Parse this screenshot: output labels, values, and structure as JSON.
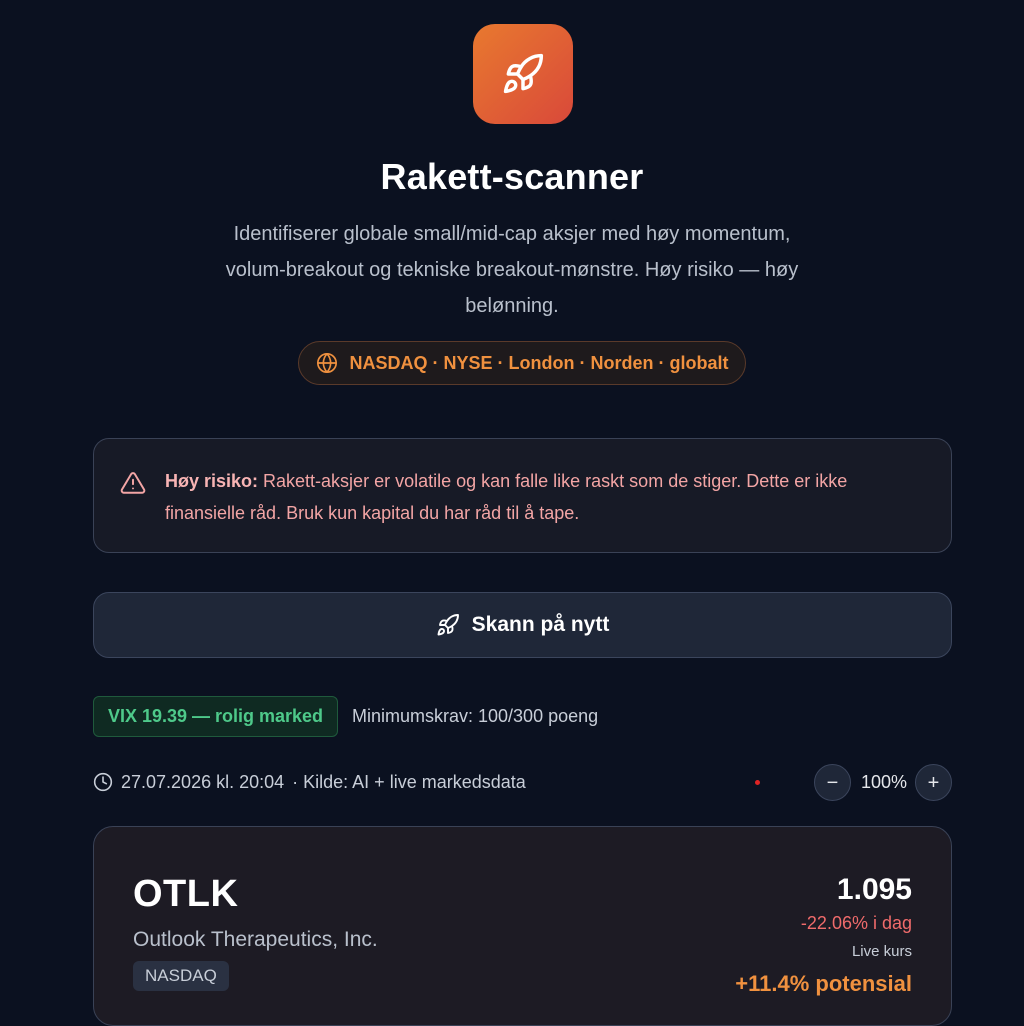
{
  "header": {
    "title": "Rakett-scanner",
    "subtitle": "Identifiserer globale small/mid-cap aksjer med høy momentum, volum-breakout og tekniske breakout-mønstre. Høy risiko — høy belønning.",
    "markets": "NASDAQ · NYSE · London · Norden · globalt"
  },
  "warning": {
    "label": "Høy risiko:",
    "text": " Rakett-aksjer er volatile og kan falle like raskt som de stiger. Dette er ikke finansielle råd. Bruk kun kapital du har råd til å tape."
  },
  "scan_button": {
    "label": "Skann på nytt"
  },
  "status": {
    "vix": "VIX 19.39 — rolig marked",
    "min_requirement": "Minimumskrav: 100/300 poeng",
    "timestamp": "27.07.2026 kl. 20:04",
    "source": "· Kilde: AI + live markedsdata"
  },
  "zoom": {
    "value": "100%",
    "minus": "−",
    "plus": "+"
  },
  "stock": {
    "ticker": "OTLK",
    "company": "Outlook Therapeutics, Inc.",
    "exchange": "NASDAQ",
    "price": "1.095",
    "change": "-22.06% i dag",
    "price_label": "Live kurs",
    "potential": "+11.4% potensial"
  },
  "colors": {
    "background": "#0b1120",
    "accent": "#f0913f",
    "danger": "#f06b6b",
    "success": "#4ec98a"
  },
  "icons": [
    "rocket-icon",
    "globe-icon",
    "warning-triangle-icon",
    "clock-icon"
  ]
}
